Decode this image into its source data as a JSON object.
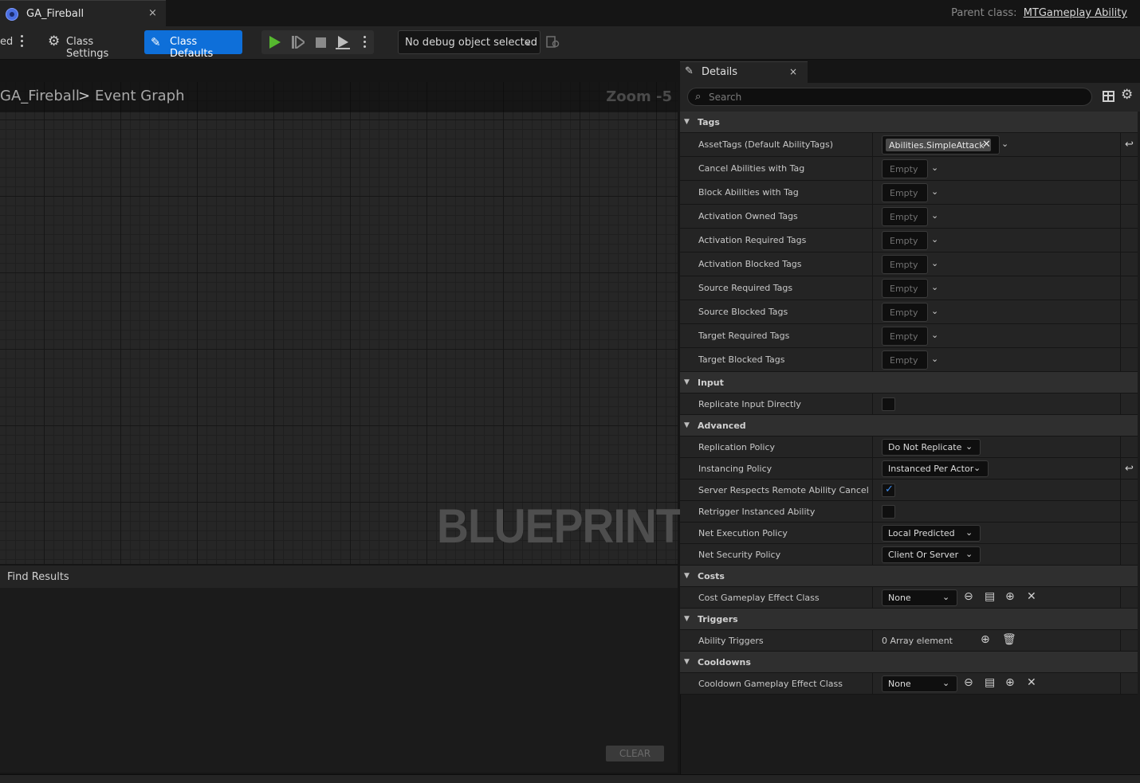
{
  "tab": {
    "title": "GA_Fireball",
    "close": "×"
  },
  "parent_class": {
    "label": "Parent class:",
    "value": "MTGameplay Ability"
  },
  "toolbar": {
    "left_fragment": "ed",
    "class_settings": "Class Settings",
    "class_defaults": "Class Defaults",
    "debug_object": "No debug object selected"
  },
  "graph": {
    "breadcrumb_root": "GA_Fireball",
    "breadcrumb_separator": ">",
    "breadcrumb_graph": "Event Graph",
    "zoom": "Zoom -5",
    "watermark": "BLUEPRINT"
  },
  "find_results": {
    "tab_label": "Find Results",
    "clear_label": "CLEAR"
  },
  "details": {
    "tab_label": "Details",
    "close": "×",
    "search_placeholder": "Search",
    "categories": {
      "tags": "Tags",
      "input": "Input",
      "advanced": "Advanced",
      "costs": "Costs",
      "triggers": "Triggers",
      "cooldowns": "Cooldowns"
    },
    "asset_tags": {
      "label": "AssetTags (Default AbilityTags)",
      "tag": "Abilities.SimpleAttack"
    },
    "empty_label": "Empty",
    "tag_rows": [
      "Cancel Abilities with Tag",
      "Block Abilities with Tag",
      "Activation Owned Tags",
      "Activation Required Tags",
      "Activation Blocked Tags",
      "Source Required Tags",
      "Source Blocked Tags",
      "Target Required Tags",
      "Target Blocked Tags"
    ],
    "input": {
      "replicate_input_directly": {
        "label": "Replicate Input Directly",
        "checked": false
      }
    },
    "advanced": {
      "replication_policy": {
        "label": "Replication Policy",
        "value": "Do Not Replicate"
      },
      "instancing_policy": {
        "label": "Instancing Policy",
        "value": "Instanced Per Actor"
      },
      "server_respects": {
        "label": "Server Respects Remote Ability Cancella...",
        "checked": true
      },
      "retrigger": {
        "label": "Retrigger Instanced Ability",
        "checked": false
      },
      "net_execution_policy": {
        "label": "Net Execution Policy",
        "value": "Local Predicted"
      },
      "net_security_policy": {
        "label": "Net Security Policy",
        "value": "Client Or Server"
      }
    },
    "costs": {
      "cost_effect": {
        "label": "Cost Gameplay Effect Class",
        "value": "None"
      }
    },
    "triggers": {
      "ability_triggers": {
        "label": "Ability Triggers",
        "value": "0 Array element"
      }
    },
    "cooldowns": {
      "cooldown_effect": {
        "label": "Cooldown Gameplay Effect Class",
        "value": "None"
      }
    }
  },
  "colors": {
    "accent": "#0e6fd9",
    "play": "#56b82f",
    "checkmark": "#3d8cf0"
  }
}
